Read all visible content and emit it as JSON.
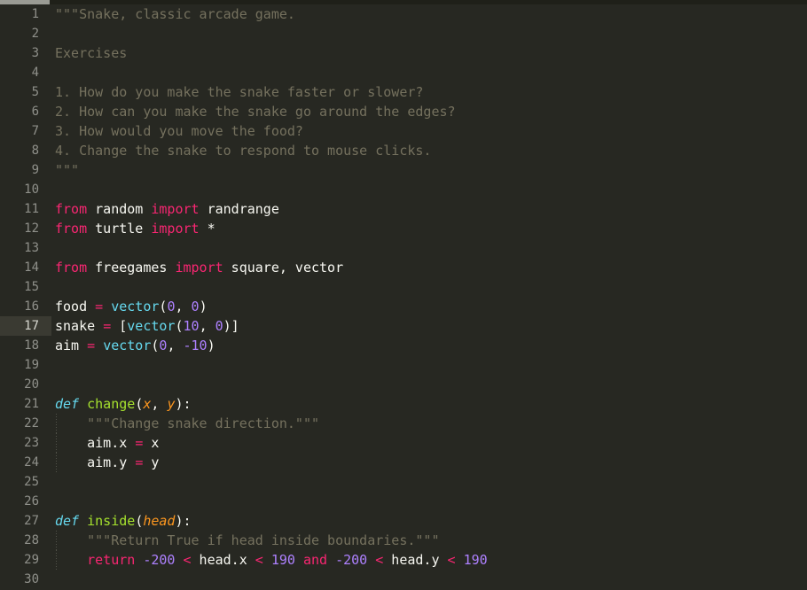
{
  "editor": {
    "theme_name": "Monokai",
    "background": "#272822",
    "current_line_number": 17,
    "first_visible_line": 1,
    "last_visible_line": 30,
    "colors": {
      "background": "#272822",
      "gutter_text": "#8f908a",
      "current_line_gutter": "#3a3a32",
      "plain_text": "#f8f8f2",
      "keyword": "#f92672",
      "definition_keyword": "#66d9ef",
      "function_name": "#a6e22e",
      "parameter": "#fd971f",
      "number": "#ae81ff",
      "docstring": "#75715e",
      "scrollbar_thumb": "#9a9b94"
    }
  },
  "scrollbar": {
    "orientation": "horizontal",
    "position": "top"
  },
  "lines": [
    {
      "n": "1",
      "indent": 0,
      "tokens": [
        {
          "t": "\"\"\"Snake, classic arcade game.",
          "c": "tok-doc"
        }
      ]
    },
    {
      "n": "2",
      "indent": 0,
      "tokens": []
    },
    {
      "n": "3",
      "indent": 0,
      "tokens": [
        {
          "t": "Exercises",
          "c": "tok-doc"
        }
      ]
    },
    {
      "n": "4",
      "indent": 0,
      "tokens": []
    },
    {
      "n": "5",
      "indent": 0,
      "tokens": [
        {
          "t": "1. How do you make the snake faster or slower?",
          "c": "tok-doc"
        }
      ]
    },
    {
      "n": "6",
      "indent": 0,
      "tokens": [
        {
          "t": "2. How can you make the snake go around the edges?",
          "c": "tok-doc"
        }
      ]
    },
    {
      "n": "7",
      "indent": 0,
      "tokens": [
        {
          "t": "3. How would you move the food?",
          "c": "tok-doc"
        }
      ]
    },
    {
      "n": "8",
      "indent": 0,
      "tokens": [
        {
          "t": "4. Change the snake to respond to mouse clicks.",
          "c": "tok-doc"
        }
      ]
    },
    {
      "n": "9",
      "indent": 0,
      "tokens": [
        {
          "t": "\"\"\"",
          "c": "tok-doc"
        }
      ]
    },
    {
      "n": "10",
      "indent": 0,
      "tokens": []
    },
    {
      "n": "11",
      "indent": 0,
      "tokens": [
        {
          "t": "from",
          "c": "tok-kw"
        },
        {
          "t": " random ",
          "c": "tok-plain"
        },
        {
          "t": "import",
          "c": "tok-kw"
        },
        {
          "t": " randrange",
          "c": "tok-plain"
        }
      ]
    },
    {
      "n": "12",
      "indent": 0,
      "tokens": [
        {
          "t": "from",
          "c": "tok-kw"
        },
        {
          "t": " turtle ",
          "c": "tok-plain"
        },
        {
          "t": "import",
          "c": "tok-kw"
        },
        {
          "t": " *",
          "c": "tok-plain"
        }
      ]
    },
    {
      "n": "13",
      "indent": 0,
      "tokens": []
    },
    {
      "n": "14",
      "indent": 0,
      "tokens": [
        {
          "t": "from",
          "c": "tok-kw"
        },
        {
          "t": " freegames ",
          "c": "tok-plain"
        },
        {
          "t": "import",
          "c": "tok-kw"
        },
        {
          "t": " square, vector",
          "c": "tok-plain"
        }
      ]
    },
    {
      "n": "15",
      "indent": 0,
      "tokens": []
    },
    {
      "n": "16",
      "indent": 0,
      "tokens": [
        {
          "t": "food ",
          "c": "tok-plain"
        },
        {
          "t": "=",
          "c": "tok-op"
        },
        {
          "t": " ",
          "c": "tok-plain"
        },
        {
          "t": "vector",
          "c": "tok-call"
        },
        {
          "t": "(",
          "c": "tok-punct"
        },
        {
          "t": "0",
          "c": "tok-num"
        },
        {
          "t": ", ",
          "c": "tok-punct"
        },
        {
          "t": "0",
          "c": "tok-num"
        },
        {
          "t": ")",
          "c": "tok-punct"
        }
      ]
    },
    {
      "n": "17",
      "indent": 0,
      "current": true,
      "tokens": [
        {
          "t": "snake ",
          "c": "tok-plain"
        },
        {
          "t": "=",
          "c": "tok-op"
        },
        {
          "t": " [",
          "c": "tok-punct"
        },
        {
          "t": "vector",
          "c": "tok-call"
        },
        {
          "t": "(",
          "c": "tok-punct"
        },
        {
          "t": "10",
          "c": "tok-num"
        },
        {
          "t": ", ",
          "c": "tok-punct"
        },
        {
          "t": "0",
          "c": "tok-num"
        },
        {
          "t": ")]",
          "c": "tok-punct"
        }
      ]
    },
    {
      "n": "18",
      "indent": 0,
      "tokens": [
        {
          "t": "aim ",
          "c": "tok-plain"
        },
        {
          "t": "=",
          "c": "tok-op"
        },
        {
          "t": " ",
          "c": "tok-plain"
        },
        {
          "t": "vector",
          "c": "tok-call"
        },
        {
          "t": "(",
          "c": "tok-punct"
        },
        {
          "t": "0",
          "c": "tok-num"
        },
        {
          "t": ", ",
          "c": "tok-punct"
        },
        {
          "t": "-10",
          "c": "tok-num"
        },
        {
          "t": ")",
          "c": "tok-punct"
        }
      ]
    },
    {
      "n": "19",
      "indent": 0,
      "tokens": []
    },
    {
      "n": "20",
      "indent": 0,
      "tokens": []
    },
    {
      "n": "21",
      "indent": 0,
      "tokens": [
        {
          "t": "def",
          "c": "tok-def"
        },
        {
          "t": " ",
          "c": "tok-plain"
        },
        {
          "t": "change",
          "c": "tok-fn"
        },
        {
          "t": "(",
          "c": "tok-punct"
        },
        {
          "t": "x",
          "c": "tok-param"
        },
        {
          "t": ", ",
          "c": "tok-punct"
        },
        {
          "t": "y",
          "c": "tok-param"
        },
        {
          "t": "):",
          "c": "tok-punct"
        }
      ]
    },
    {
      "n": "22",
      "indent": 1,
      "tokens": [
        {
          "t": "    \"\"\"Change snake direction.\"\"\"",
          "c": "tok-doc"
        }
      ]
    },
    {
      "n": "23",
      "indent": 1,
      "tokens": [
        {
          "t": "    aim.x ",
          "c": "tok-plain"
        },
        {
          "t": "=",
          "c": "tok-op"
        },
        {
          "t": " x",
          "c": "tok-plain"
        }
      ]
    },
    {
      "n": "24",
      "indent": 1,
      "tokens": [
        {
          "t": "    aim.y ",
          "c": "tok-plain"
        },
        {
          "t": "=",
          "c": "tok-op"
        },
        {
          "t": " y",
          "c": "tok-plain"
        }
      ]
    },
    {
      "n": "25",
      "indent": 0,
      "tokens": []
    },
    {
      "n": "26",
      "indent": 0,
      "tokens": []
    },
    {
      "n": "27",
      "indent": 0,
      "tokens": [
        {
          "t": "def",
          "c": "tok-def"
        },
        {
          "t": " ",
          "c": "tok-plain"
        },
        {
          "t": "inside",
          "c": "tok-fn"
        },
        {
          "t": "(",
          "c": "tok-punct"
        },
        {
          "t": "head",
          "c": "tok-param"
        },
        {
          "t": "):",
          "c": "tok-punct"
        }
      ]
    },
    {
      "n": "28",
      "indent": 1,
      "tokens": [
        {
          "t": "    \"\"\"Return True if head inside boundaries.\"\"\"",
          "c": "tok-doc"
        }
      ]
    },
    {
      "n": "29",
      "indent": 1,
      "tokens": [
        {
          "t": "    ",
          "c": "tok-plain"
        },
        {
          "t": "return",
          "c": "tok-kw"
        },
        {
          "t": " ",
          "c": "tok-plain"
        },
        {
          "t": "-200",
          "c": "tok-num"
        },
        {
          "t": " ",
          "c": "tok-plain"
        },
        {
          "t": "<",
          "c": "tok-op"
        },
        {
          "t": " head.x ",
          "c": "tok-plain"
        },
        {
          "t": "<",
          "c": "tok-op"
        },
        {
          "t": " ",
          "c": "tok-plain"
        },
        {
          "t": "190",
          "c": "tok-num"
        },
        {
          "t": " ",
          "c": "tok-plain"
        },
        {
          "t": "and",
          "c": "tok-kw"
        },
        {
          "t": " ",
          "c": "tok-plain"
        },
        {
          "t": "-200",
          "c": "tok-num"
        },
        {
          "t": " ",
          "c": "tok-plain"
        },
        {
          "t": "<",
          "c": "tok-op"
        },
        {
          "t": " head.y ",
          "c": "tok-plain"
        },
        {
          "t": "<",
          "c": "tok-op"
        },
        {
          "t": " ",
          "c": "tok-plain"
        },
        {
          "t": "190",
          "c": "tok-num"
        }
      ]
    },
    {
      "n": "30",
      "indent": 0,
      "tokens": []
    }
  ]
}
